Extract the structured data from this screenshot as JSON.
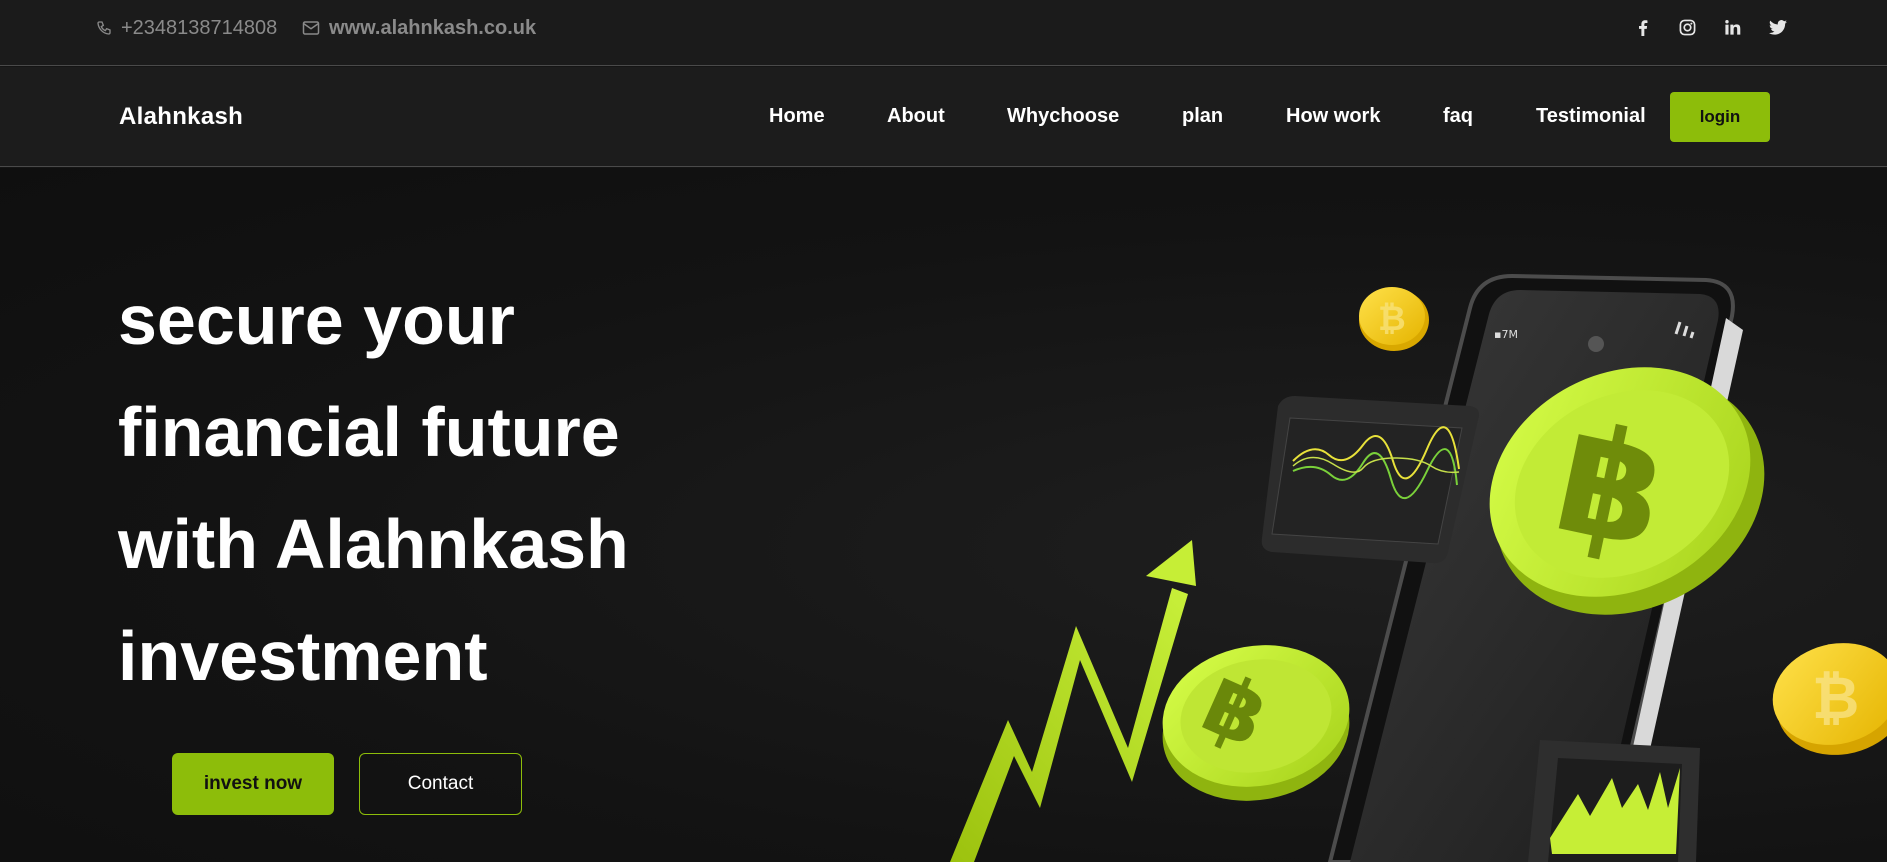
{
  "topbar": {
    "phone": "+2348138714808",
    "website": "www.alahnkash.co.uk",
    "socials": [
      "facebook-icon",
      "instagram-icon",
      "linkedin-icon",
      "twitter-icon"
    ]
  },
  "navbar": {
    "brand": "Alahnkash",
    "items": [
      "Home",
      "About",
      "Whychoose",
      "plan",
      "How work",
      "faq",
      "Testimonial"
    ],
    "login_label": "login"
  },
  "hero": {
    "headline_lines": [
      "secure your",
      "financial future",
      "with Alahnkash",
      "investment"
    ],
    "invest_label": "invest now",
    "contact_label": "Contact"
  },
  "colors": {
    "accent": "#8dbd0a",
    "coin_green": "#c5f23f",
    "coin_gold": "#f5c800",
    "background": "#151515"
  }
}
